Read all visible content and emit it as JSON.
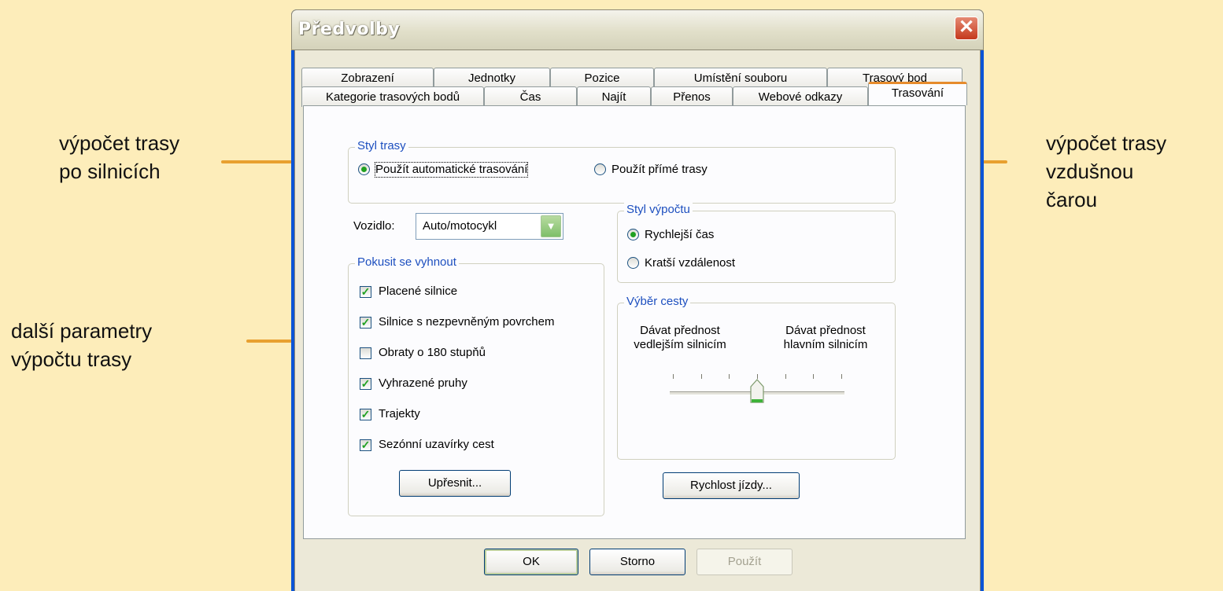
{
  "annotations": {
    "left_top": [
      "výpočet trasy",
      "po silnicích"
    ],
    "left_bottom": [
      "další parametry",
      "výpočtu trasy"
    ],
    "right": [
      "výpočet trasy",
      "vzdušnou",
      "čarou"
    ],
    "arrow_color": "#e8a030"
  },
  "dialog": {
    "title": "Předvolby",
    "close_icon": "close-icon",
    "tabs_row1": [
      "Zobrazení",
      "Jednotky",
      "Pozice",
      "Umístění souboru",
      "Trasový bod"
    ],
    "tabs_row2": [
      "Kategorie trasových bodů",
      "Čas",
      "Najít",
      "Přenos",
      "Webové odkazy",
      "Trasování"
    ],
    "active_tab": "Trasování"
  },
  "route_style": {
    "legend": "Styl trasy",
    "option_auto": "Použít automatické trasování",
    "option_direct": "Použít přímé trasy",
    "selected": "auto"
  },
  "vehicle": {
    "label": "Vozidlo:",
    "value": "Auto/motocykl"
  },
  "avoid": {
    "legend": "Pokusit se vyhnout",
    "items": [
      {
        "label": "Placené silnice",
        "checked": true
      },
      {
        "label": "Silnice s nezpevněným povrchem",
        "checked": true
      },
      {
        "label": "Obraty o 180 stupňů",
        "checked": false
      },
      {
        "label": "Vyhrazené pruhy",
        "checked": true
      },
      {
        "label": "Trajekty",
        "checked": true
      },
      {
        "label": "Sezónní uzavírky cest",
        "checked": true
      }
    ],
    "refine_button": "Upřesnit..."
  },
  "calc_style": {
    "legend": "Styl výpočtu",
    "option_fast": "Rychlejší čas",
    "option_short": "Kratší vzdálenost",
    "selected": "fast"
  },
  "road_choice": {
    "legend": "Výběr cesty",
    "left_label": [
      "Dávat přednost",
      "vedlejším silnicím"
    ],
    "right_label": [
      "Dávat přednost",
      "hlavním silnicím"
    ],
    "slider_ticks": 7,
    "slider_position_index": 3,
    "speed_button": "Rychlost jízdy..."
  },
  "footer": {
    "ok": "OK",
    "cancel": "Storno",
    "apply": "Použít"
  }
}
